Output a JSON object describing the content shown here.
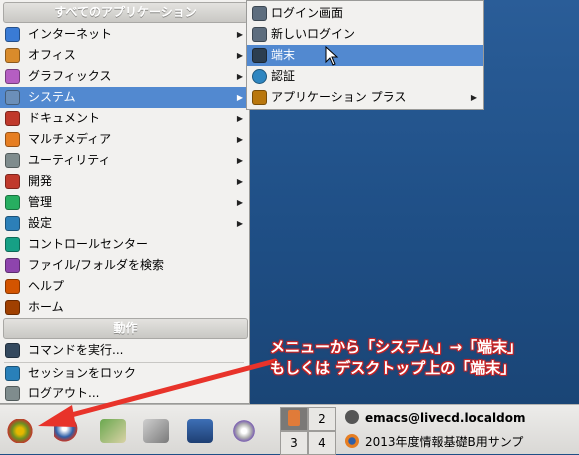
{
  "main_menu": {
    "header_all": "すべてのアプリケーション",
    "items": [
      {
        "label": "インターネット",
        "icon": "globe-icon",
        "color": "#3a7bd5",
        "submenu": true
      },
      {
        "label": "オフィス",
        "icon": "office-icon",
        "color": "#d98b2b",
        "submenu": true
      },
      {
        "label": "グラフィックス",
        "icon": "graphics-icon",
        "color": "#b55ec2",
        "submenu": true
      },
      {
        "label": "システム",
        "icon": "system-icon",
        "color": "#6b8fb9",
        "submenu": true,
        "highlighted": true
      },
      {
        "label": "ドキュメント",
        "icon": "document-icon",
        "color": "#c0392b",
        "submenu": true
      },
      {
        "label": "マルチメディア",
        "icon": "multimedia-icon",
        "color": "#e67e22",
        "submenu": true
      },
      {
        "label": "ユーティリティ",
        "icon": "utility-icon",
        "color": "#7f8c8d",
        "submenu": true
      },
      {
        "label": "開発",
        "icon": "development-icon",
        "color": "#c0392b",
        "submenu": true
      },
      {
        "label": "管理",
        "icon": "admin-icon",
        "color": "#27ae60",
        "submenu": true
      },
      {
        "label": "設定",
        "icon": "settings-icon",
        "color": "#2c7fb8",
        "submenu": true
      },
      {
        "label": "コントロールセンター",
        "icon": "control-center-icon",
        "color": "#16a085",
        "submenu": false
      },
      {
        "label": "ファイル/フォルダを検索",
        "icon": "search-icon",
        "color": "#8e44ad",
        "submenu": false
      },
      {
        "label": "ヘルプ",
        "icon": "help-icon",
        "color": "#d35400",
        "submenu": false
      },
      {
        "label": "ホーム",
        "icon": "home-icon",
        "color": "#a04000",
        "submenu": false
      }
    ],
    "header_actions": "動作",
    "actions": [
      {
        "label": "コマンドを実行...",
        "icon": "run-icon",
        "color": "#34495e"
      },
      {
        "label": "セッションをロック",
        "icon": "lock-icon",
        "color": "#2980b9"
      },
      {
        "label": "ログアウト...",
        "icon": "logout-icon",
        "color": "#7f8c8d"
      }
    ]
  },
  "submenu": {
    "items": [
      {
        "label": "ログイン画面",
        "icon": "login-screen-icon",
        "color": "#5d6d7e"
      },
      {
        "label": "新しいログイン",
        "icon": "new-login-icon",
        "color": "#5d6d7e"
      },
      {
        "label": "端末",
        "icon": "terminal-icon",
        "color": "#2c3e50",
        "highlighted": true
      },
      {
        "label": "認証",
        "icon": "auth-icon",
        "color": "#2e86c1"
      },
      {
        "label": "アプリケーション プラス",
        "icon": "app-plus-icon",
        "color": "#b9770e",
        "submenu": true
      }
    ]
  },
  "panel": {
    "workspaces": [
      "1",
      "2",
      "3",
      "4"
    ],
    "tasks": [
      "emacs@livecd.localdom",
      "2013年度情報基礎B用サンプ"
    ]
  },
  "annotation": {
    "line1": "メニューから「システム」→「端末」",
    "line2": "もしくは デスクトップ上の「端末」"
  },
  "colors": {
    "highlight": "#5289d0",
    "arrow": "#e8332a"
  }
}
